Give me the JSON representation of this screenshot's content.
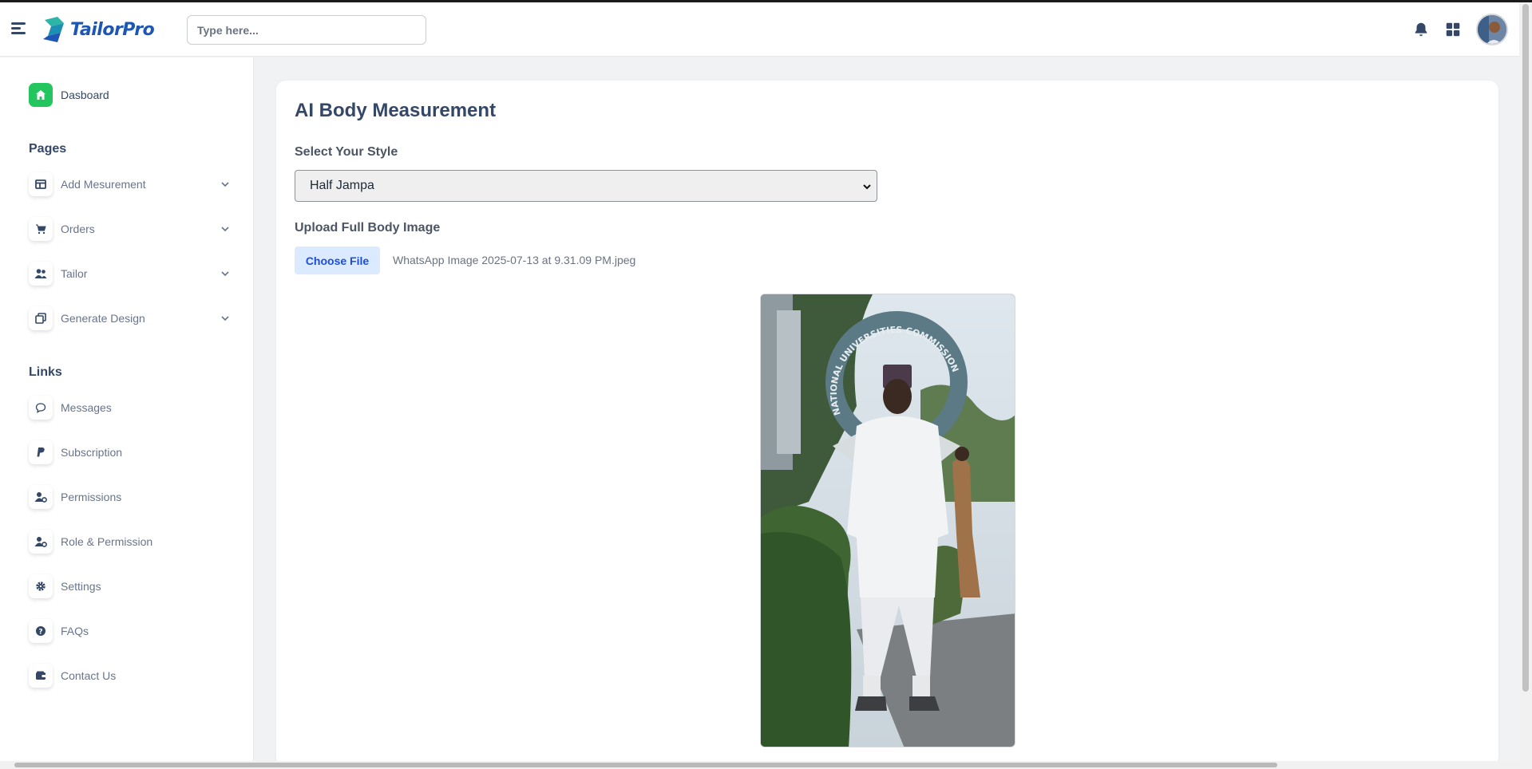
{
  "brand": {
    "name": "TailorPro",
    "color": "#1d56b5"
  },
  "search": {
    "placeholder": "Type here..."
  },
  "navbar": {
    "icons": [
      "menu-icon",
      "bell-icon",
      "apps-grid-icon",
      "avatar"
    ]
  },
  "sidebar": {
    "dashboard": {
      "label": "Dasboard",
      "icon": "home-icon",
      "accent": "#22c55e"
    },
    "pages_title": "Pages",
    "pages": [
      {
        "label": "Add Mesurement",
        "icon": "table-icon"
      },
      {
        "label": "Orders",
        "icon": "cart-icon"
      },
      {
        "label": "Tailor",
        "icon": "users-icon"
      },
      {
        "label": "Generate Design",
        "icon": "copy-icon"
      }
    ],
    "links_title": "Links",
    "links": [
      {
        "label": "Messages",
        "icon": "chat-icon"
      },
      {
        "label": "Subscription",
        "icon": "paypal-icon"
      },
      {
        "label": "Permissions",
        "icon": "user-gear-icon"
      },
      {
        "label": "Role & Permission",
        "icon": "user-gear-icon"
      },
      {
        "label": "Settings",
        "icon": "gear-icon"
      },
      {
        "label": "FAQs",
        "icon": "question-icon"
      },
      {
        "label": "Contact Us",
        "icon": "wallet-icon"
      }
    ]
  },
  "main": {
    "title": "AI Body Measurement",
    "style_label": "Select Your Style",
    "style_value": "Half Jampa",
    "upload_label": "Upload Full Body Image",
    "choose_file": "Choose File",
    "file_name": "WhatsApp Image 2025-07-13 at 9.31.09 PM.jpeg",
    "photo_sign_text": "NATIONAL UNIVERSITIES COMMISSION"
  }
}
